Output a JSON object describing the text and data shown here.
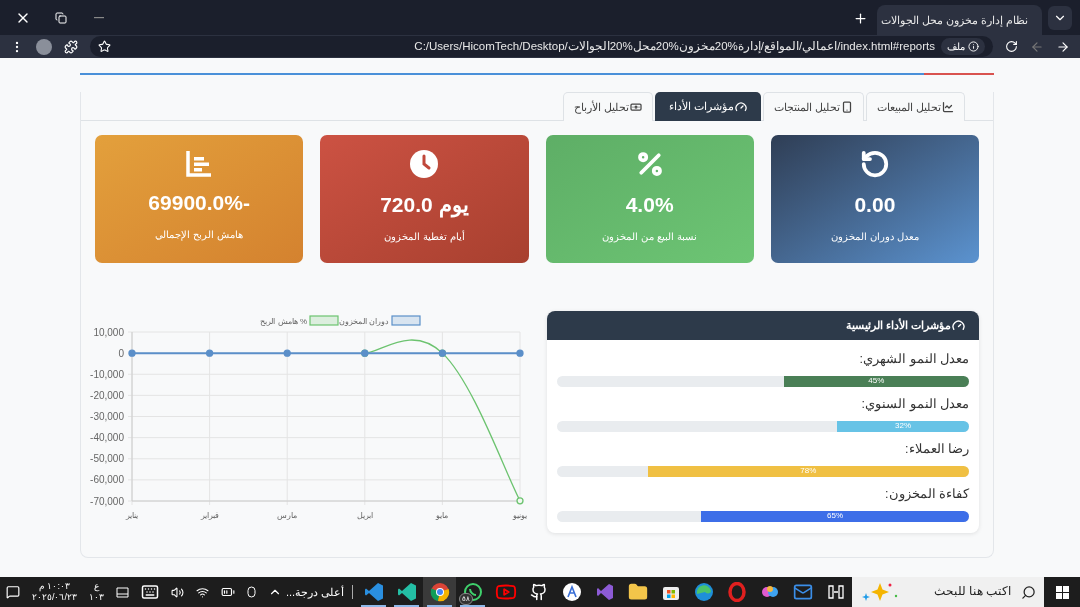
{
  "browser": {
    "tab_title": "نظام إدارة مخزون محل الجوالات",
    "url_chip": "ملف",
    "url": "C:/Users/HicomTech/Desktop/اعمالي/المواقع/إدارة%20مخزون%20محل%20الجوالات/index.html#reports"
  },
  "tabs": [
    {
      "label": "تحليل المبيعات",
      "kind": "chart",
      "selected": false
    },
    {
      "label": "تحليل المنتجات",
      "kind": "phone",
      "selected": false
    },
    {
      "label": "مؤشرات الأداء",
      "kind": "gauge",
      "selected": true
    },
    {
      "label": "تحليل الأرباح",
      "kind": "money",
      "selected": false
    }
  ],
  "cards": [
    {
      "kind": "rotate",
      "value": "0.00",
      "label": "معدل دوران المخزون",
      "color": "#3d5a80"
    },
    {
      "kind": "percent",
      "value": "4.0%",
      "label": "نسبة البيع من المخزون",
      "color": "#5cb46a"
    },
    {
      "kind": "clock",
      "value": "720.0 يوم",
      "label": "أيام تغطية المخزون",
      "color": "#c0483b"
    },
    {
      "kind": "list",
      "value": "69900.0%-",
      "label": "هامش الربح الإجمالي",
      "color": "#dc8f36"
    }
  ],
  "chart": {
    "chart_data": {
      "type": "line",
      "categories": [
        "يناير",
        "فبراير",
        "مارس",
        "ابريل",
        "مايو",
        "يونيو"
      ],
      "grid": true,
      "legend": true,
      "series": [
        {
          "name": "دوران المخزون",
          "color": "#5b8fc9",
          "marker": true,
          "values": [
            0,
            0,
            0,
            0,
            0,
            0
          ]
        },
        {
          "name": "هامش الربح %",
          "color": "#6cc36f",
          "marker": true,
          "values": [
            null,
            null,
            null,
            0,
            0,
            -69900
          ]
        }
      ],
      "ylim": [
        -70000,
        10000
      ],
      "yticks": [
        {
          "value": 10000,
          "label": "10,000"
        },
        {
          "value": 0,
          "label": "0"
        },
        {
          "value": -10000,
          "label": "-10,000"
        },
        {
          "value": -20000,
          "label": "-20,000"
        },
        {
          "value": -30000,
          "label": "-30,000"
        },
        {
          "value": -40000,
          "label": "-40,000"
        },
        {
          "value": -50000,
          "label": "-50,000"
        },
        {
          "value": -60000,
          "label": "-60,000"
        },
        {
          "value": -70000,
          "label": "-70,000"
        }
      ]
    }
  },
  "kpi_panel": {
    "title": "مؤشرات الأداء الرئيسية",
    "items": [
      {
        "label": "معدل النمو الشهري:",
        "reading": "45%",
        "level": 0.45,
        "color": "#4a7f56"
      },
      {
        "label": "معدل النمو السنوي:",
        "reading": "32%",
        "level": 0.32,
        "color": "#67c3e6"
      },
      {
        "label": "رضا العملاء:",
        "reading": "78%",
        "level": 0.78,
        "color": "#f0c043"
      },
      {
        "label": "كفاءة المخزون:",
        "reading": "65%",
        "level": 0.65,
        "color": "#3d6ee8"
      }
    ]
  },
  "taskbar": {
    "search_placeholder": "اكتب هنا للبحث",
    "apps": [
      {
        "kind": "taskview",
        "open": false,
        "selected": false
      },
      {
        "kind": "outlook",
        "open": false,
        "selected": false
      },
      {
        "kind": "copilot",
        "open": false,
        "selected": false
      },
      {
        "kind": "opera",
        "open": false,
        "selected": false
      },
      {
        "kind": "edge",
        "open": false,
        "selected": false
      },
      {
        "kind": "store",
        "open": false,
        "selected": false
      },
      {
        "kind": "folder",
        "open": false,
        "selected": false
      },
      {
        "kind": "vs",
        "open": false,
        "selected": false
      },
      {
        "kind": "appstore",
        "open": false,
        "selected": false
      },
      {
        "kind": "github",
        "open": false,
        "selected": false
      },
      {
        "kind": "youtube",
        "open": false,
        "selected": false
      },
      {
        "kind": "whatsapp",
        "open": true,
        "selected": false,
        "badge": "٥٨"
      },
      {
        "kind": "chrome",
        "open": true,
        "selected": true
      },
      {
        "kind": "vscode-insiders",
        "open": true,
        "selected": false
      },
      {
        "kind": "vscode",
        "open": true,
        "selected": false
      }
    ],
    "weather": "أعلى درجة...",
    "language": "ع",
    "language_sub": "١٠٣",
    "time": "١٠:٠٣ م",
    "date": "٢٠٢٥/٠٦/٢٣"
  }
}
